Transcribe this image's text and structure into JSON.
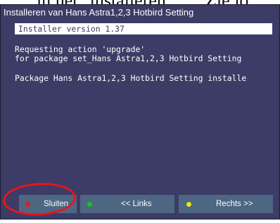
{
  "top_cut_text": "iu het \"installeren\"… . Zie jo",
  "window": {
    "title": "Installeren van Hans Astra1,2,3 Hotbird Setting"
  },
  "content": {
    "version": "Installer version 1.37",
    "requesting": "Requesting action 'upgrade'",
    "for_package": "for package set_Hans Astra1,2,3 Hotbird Setting",
    "package_line": "Package Hans Astra1,2,3 Hotbird Setting installe"
  },
  "buttons": {
    "close": {
      "label": "Sluiten",
      "dot_color": "#e21c1c"
    },
    "left": {
      "label": "<< Links",
      "dot_color": "#19c419"
    },
    "right": {
      "label": "Rechts >>",
      "dot_color": "#f0e21a"
    }
  },
  "colors": {
    "background": "#3c3c66",
    "button": "#4d6782",
    "annotation": "#e8151b"
  }
}
